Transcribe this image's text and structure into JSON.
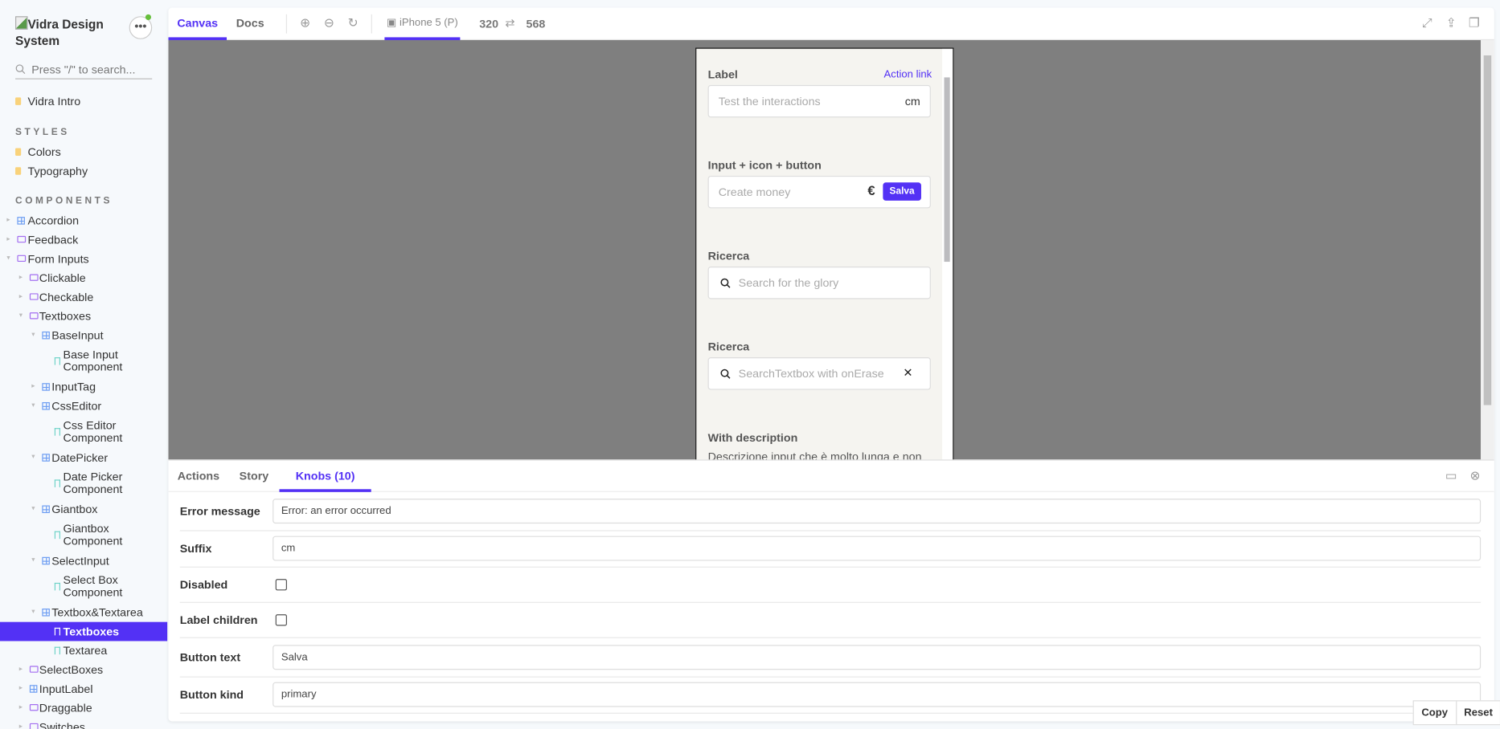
{
  "sidebar": {
    "brand": "Vidra Design System",
    "menu_label": "•••",
    "search_placeholder": "Press \"/\" to search...",
    "intro": "Vidra Intro",
    "styles_heading": "STYLES",
    "styles": [
      "Colors",
      "Typography"
    ],
    "components_heading": "COMPONENTS",
    "items": [
      {
        "label": "Accordion",
        "level": 0,
        "icon": "grid",
        "caret": "▸"
      },
      {
        "label": "Feedback",
        "level": 0,
        "icon": "fold",
        "caret": "▸"
      },
      {
        "label": "Form Inputs",
        "level": 0,
        "icon": "fold",
        "caret": "▾"
      },
      {
        "label": "Clickable",
        "level": 1,
        "icon": "fold",
        "caret": "▸"
      },
      {
        "label": "Checkable",
        "level": 1,
        "icon": "fold",
        "caret": "▸"
      },
      {
        "label": "Textboxes",
        "level": 1,
        "icon": "fold",
        "caret": "▾"
      },
      {
        "label": "BaseInput",
        "level": 2,
        "icon": "grid",
        "caret": "▾"
      },
      {
        "label": "Base Input Component",
        "level": 3,
        "icon": "mark",
        "caret": ""
      },
      {
        "label": "InputTag",
        "level": 2,
        "icon": "grid",
        "caret": "▸"
      },
      {
        "label": "CssEditor",
        "level": 2,
        "icon": "grid",
        "caret": "▾"
      },
      {
        "label": "Css Editor Component",
        "level": 3,
        "icon": "mark",
        "caret": ""
      },
      {
        "label": "DatePicker",
        "level": 2,
        "icon": "grid",
        "caret": "▾"
      },
      {
        "label": "Date Picker Component",
        "level": 3,
        "icon": "mark",
        "caret": ""
      },
      {
        "label": "Giantbox",
        "level": 2,
        "icon": "grid",
        "caret": "▾"
      },
      {
        "label": "Giantbox Component",
        "level": 3,
        "icon": "mark",
        "caret": ""
      },
      {
        "label": "SelectInput",
        "level": 2,
        "icon": "grid",
        "caret": "▾"
      },
      {
        "label": "Select Box Component",
        "level": 3,
        "icon": "mark",
        "caret": ""
      },
      {
        "label": "Textbox&Textarea",
        "level": 2,
        "icon": "grid",
        "caret": "▾"
      },
      {
        "label": "Textboxes",
        "level": 3,
        "icon": "mark",
        "caret": "",
        "selected": true
      },
      {
        "label": "Textarea",
        "level": 3,
        "icon": "mark",
        "caret": ""
      },
      {
        "label": "SelectBoxes",
        "level": 1,
        "icon": "fold",
        "caret": "▸"
      },
      {
        "label": "InputLabel",
        "level": 1,
        "icon": "grid",
        "caret": "▸"
      },
      {
        "label": "Draggable",
        "level": 1,
        "icon": "fold",
        "caret": "▸"
      },
      {
        "label": "Switches",
        "level": 1,
        "icon": "fold",
        "caret": "▸"
      }
    ]
  },
  "toolbar": {
    "tab_canvas": "Canvas",
    "tab_docs": "Docs",
    "device": "iPhone 5 (P)",
    "width": "320",
    "swap": "⇄",
    "height": "568"
  },
  "preview": {
    "label1": "Label",
    "action_link": "Action link",
    "placeholder1": "Test the interactions",
    "suffix1": "cm",
    "label2": "Input + icon + button",
    "placeholder2": "Create money",
    "euro": "€",
    "button": "Salva",
    "label3": "Ricerca",
    "placeholder3": "Search for the glory",
    "label4": "Ricerca",
    "placeholder4": "SearchTextbox with onErase",
    "erase": "✕",
    "label5": "With description",
    "description": "Descrizione input che è molto lunga e non"
  },
  "panel": {
    "tabs": [
      "Actions",
      "Story",
      "Knobs (10)"
    ],
    "knobs": [
      {
        "label": "Error message",
        "type": "text",
        "value": "Error: an error occurred"
      },
      {
        "label": "Suffix",
        "type": "text",
        "value": "cm"
      },
      {
        "label": "Disabled",
        "type": "checkbox",
        "value": ""
      },
      {
        "label": "Label children",
        "type": "checkbox",
        "value": ""
      },
      {
        "label": "Button text",
        "type": "text",
        "value": "Salva"
      },
      {
        "label": "Button kind",
        "type": "text",
        "value": "primary"
      }
    ],
    "copy": "Copy",
    "reset": "Reset"
  },
  "colors": {
    "accent": "#5331f5",
    "canvas": "#7f7f7f"
  }
}
